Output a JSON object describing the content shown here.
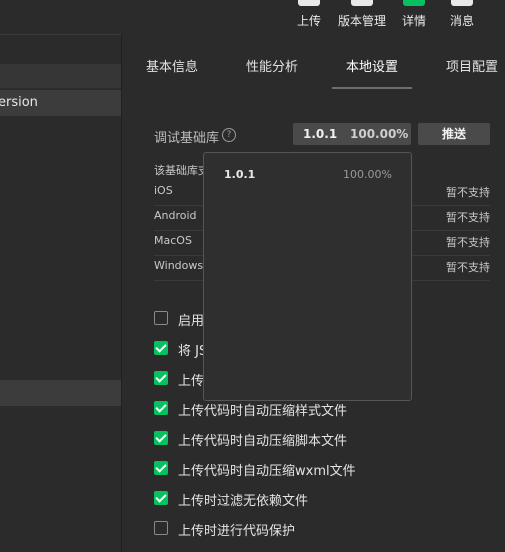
{
  "toolbar": {
    "items": [
      {
        "label": "上传",
        "icon": "upload-icon"
      },
      {
        "label": "版本管理",
        "icon": "version-icon"
      },
      {
        "label": "详情",
        "icon": "details-icon"
      },
      {
        "label": "消息",
        "icon": "message-icon"
      }
    ]
  },
  "sidebar": {
    "items": [
      {
        "label": "ersion"
      }
    ]
  },
  "tabs": [
    {
      "label": "基本信息"
    },
    {
      "label": "性能分析"
    },
    {
      "label": "本地设置",
      "active": true
    },
    {
      "label": "项目配置"
    }
  ],
  "debug_lib": {
    "label": "调试基础库",
    "help_icon": "?",
    "selected_version": "1.0.1",
    "selected_percent": "100.00%",
    "push_label": "推送",
    "support_header": "该基础库支",
    "systems": [
      {
        "name": "iOS",
        "status": "暂不支持"
      },
      {
        "name": "Android",
        "status": "暂不支持"
      },
      {
        "name": "MacOS",
        "status": "暂不支持"
      },
      {
        "name": "Windows",
        "status": "暂不支持"
      }
    ]
  },
  "dropdown": {
    "options": [
      {
        "version": "1.0.1",
        "percent": "100.00%"
      }
    ]
  },
  "options": [
    {
      "label": "启用",
      "checked": false
    },
    {
      "label": "将 JS",
      "checked": true
    },
    {
      "label": "上传",
      "checked": true
    },
    {
      "label": "上传代码时自动压缩样式文件",
      "checked": true
    },
    {
      "label": "上传代码时自动压缩脚本文件",
      "checked": true
    },
    {
      "label": "上传代码时自动压缩wxml文件",
      "checked": true
    },
    {
      "label": "上传时过滤无依赖文件",
      "checked": true
    },
    {
      "label": "上传时进行代码保护",
      "checked": false
    }
  ],
  "colors": {
    "accent_green": "#07c160",
    "background": "#2b2b2b"
  }
}
